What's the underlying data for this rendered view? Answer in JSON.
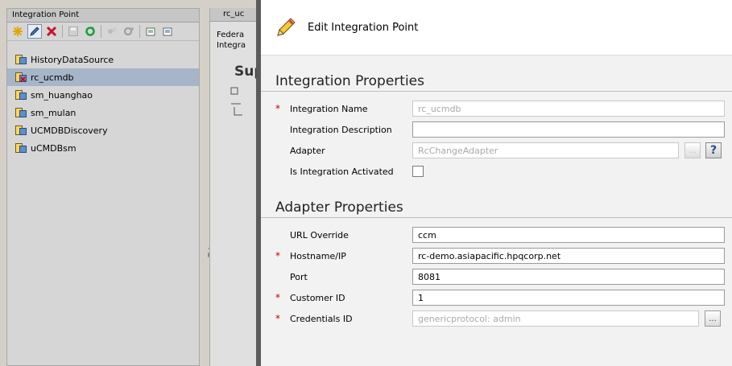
{
  "left_panel": {
    "title": "Integration Point",
    "toolbar": [
      "new-icon",
      "edit-icon",
      "delete-icon",
      "save-icon",
      "refresh-icon",
      "activate-icon",
      "deactivate-icon",
      "export-icon",
      "import-icon"
    ],
    "tree": [
      {
        "label": "HistoryDataSource",
        "selected": false
      },
      {
        "label": "rc_ucmdb",
        "selected": true
      },
      {
        "label": "sm_huanghao",
        "selected": false
      },
      {
        "label": "sm_mulan",
        "selected": false
      },
      {
        "label": "UCMDBDiscovery",
        "selected": false
      },
      {
        "label": "uCMDBsm",
        "selected": false
      }
    ]
  },
  "mid_panel": {
    "tab": "rc_uc",
    "line1": "Federa",
    "line2": "Integra",
    "heading": "Sup"
  },
  "dialog": {
    "title": "Edit Integration Point",
    "integration_section": "Integration Properties",
    "integration_name": {
      "label": "Integration Name",
      "value": "rc_ucmdb",
      "required": true
    },
    "integration_description": {
      "label": "Integration Description",
      "value": ""
    },
    "adapter": {
      "label": "Adapter",
      "value": "RcChangeAdapter"
    },
    "activated": {
      "label": "Is Integration Activated",
      "checked": false
    },
    "adapter_section": "Adapter Properties",
    "url_override": {
      "label": "URL Override",
      "value": "ccm"
    },
    "hostname": {
      "label": "Hostname/IP",
      "value": "rc-demo.asiapacific.hpqcorp.net",
      "required": true
    },
    "port": {
      "label": "Port",
      "value": "8081"
    },
    "customer_id": {
      "label": "Customer ID",
      "value": "1",
      "required": true
    },
    "credentials_id": {
      "label": "Credentials ID",
      "value": "genericprotocol: admin",
      "required": true
    },
    "required_marker": "*",
    "ellipsis": "...",
    "help": "?"
  },
  "colors": {
    "selection": "#a7b5c8",
    "required": "#c00000",
    "panel": "#d6d6d6"
  }
}
